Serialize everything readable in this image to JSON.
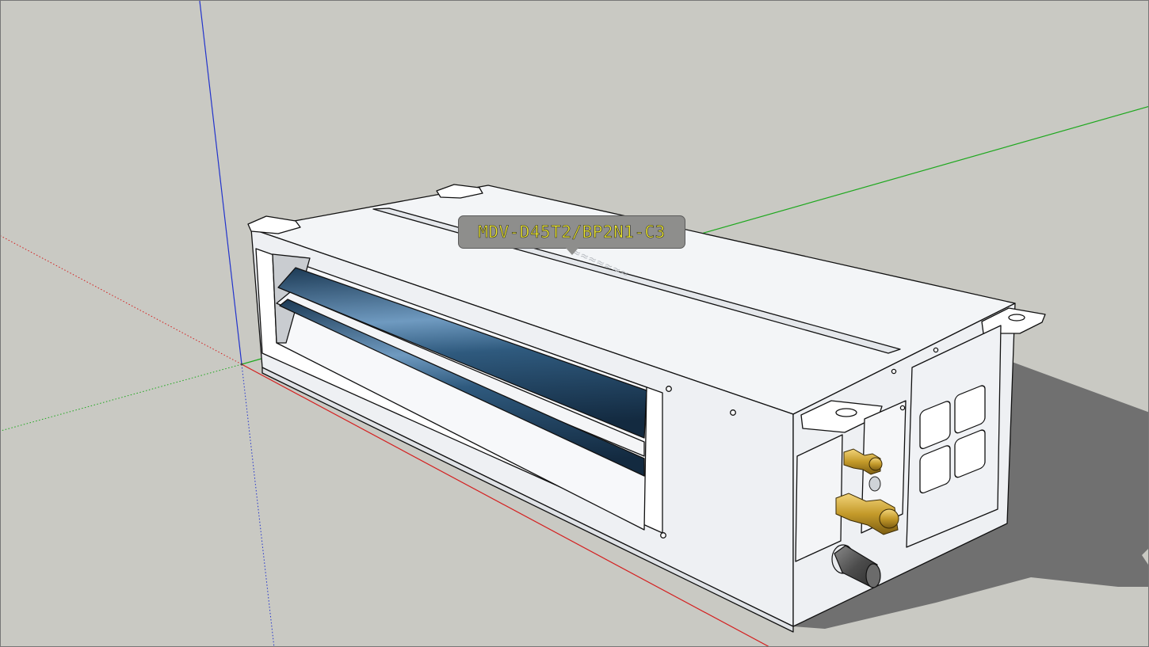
{
  "viewport": {
    "background_color": "#c9c9c3",
    "axis_colors": {
      "red": "#d42020",
      "green": "#1ea81e",
      "blue": "#2233cc"
    },
    "shadow_color": "#707070"
  },
  "model_tag": {
    "text": "MDV-D45T2/BP2N1-C3",
    "text_color": "#f2ec2c",
    "background_color": "#8e8e8c"
  },
  "unit": {
    "body_color": "#f3f5f7",
    "coil_color": "#2f5a7e",
    "fitting_color": "#c49a2a",
    "pipe_color": "#5c5c5c"
  }
}
